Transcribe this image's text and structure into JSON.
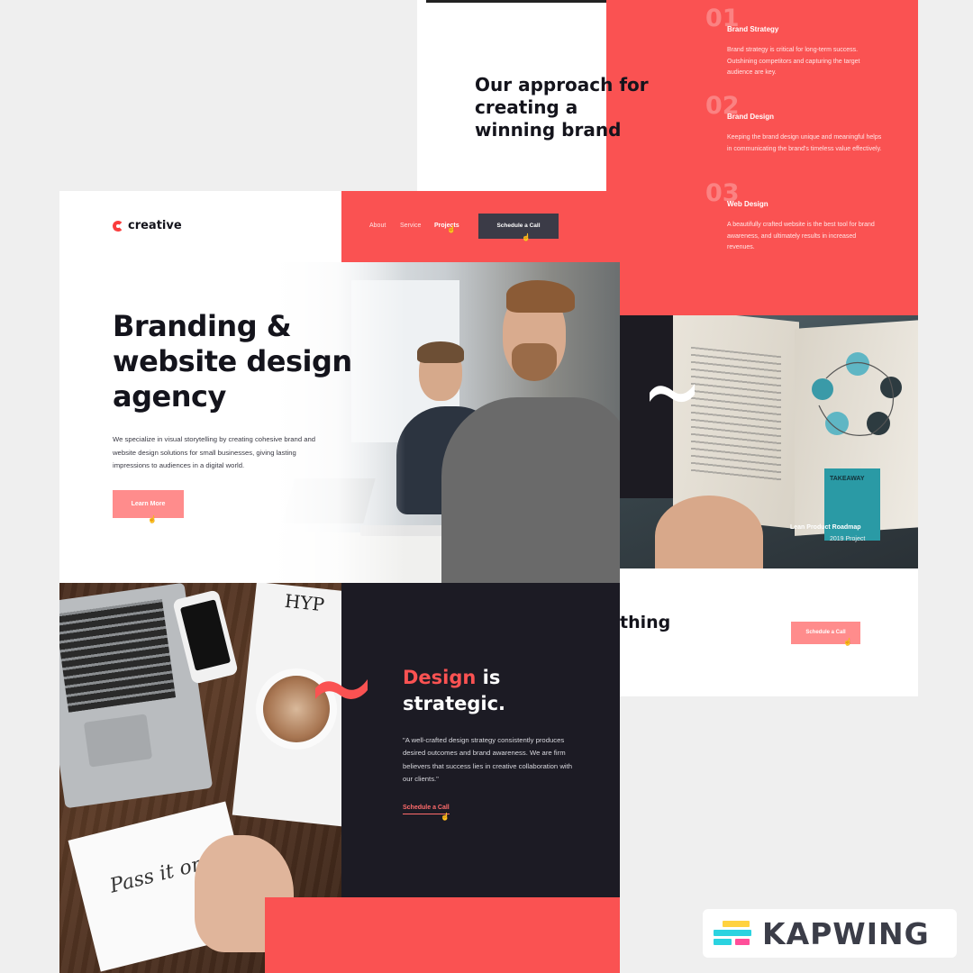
{
  "back_page": {
    "approach_title": "Our approach for creating a winning brand",
    "steps": [
      {
        "num": "01",
        "title": "Brand Strategy",
        "desc": "Brand strategy is critical for long-term success. Outshining competitors and capturing the target audience are key."
      },
      {
        "num": "02",
        "title": "Brand Design",
        "desc": "Keeping the brand design unique and meaningful helps in communicating the brand's timeless value effectively."
      },
      {
        "num": "03",
        "title": "Web Design",
        "desc": "A beautifully crafted website is the best tool for brand awareness, and ultimately results in increased revenues."
      }
    ],
    "project": {
      "title": "Lean Product Roadmap",
      "subtitle": "2019 Project",
      "book_label": "TAKEAWAY"
    },
    "partial_heading": "thing",
    "cta_label": "Schedule a Call"
  },
  "front_page": {
    "logo_text": "creative",
    "nav": {
      "links": [
        "About",
        "Service",
        "Projects"
      ],
      "active": "Projects",
      "cta_label": "Schedule a Call"
    },
    "hero": {
      "title": "Branding & website design agency",
      "description": "We specialize in visual storytelling by creating cohesive brand and website design solutions for small businesses, giving lasting impressions to audiences in a digital world.",
      "button_label": "Learn More"
    },
    "desk_photo": {
      "magazine_text": "HYP",
      "lettering": "Pass it on"
    },
    "strategic": {
      "title_accent": "Design",
      "title_rest_1": " is",
      "title_rest_2": "strategic.",
      "quote": "\"A well-crafted design strategy consistently produces desired outcomes and brand awareness. We are firm believers that success lies in creative collaboration with our clients.\"",
      "link_label": "Schedule a Call"
    }
  },
  "watermark": {
    "text": "KAPWING"
  },
  "colors": {
    "accent_red": "#fa5252",
    "button_pink": "#ff8c8c",
    "dark_navy": "#1c1b24",
    "nav_button": "#3b3b47",
    "page_bg": "#efefef",
    "kapwing_cyan": "#2bd3e0",
    "kapwing_yellow": "#ffd23f",
    "kapwing_pink": "#ff4f9a"
  },
  "icons": {
    "cursor": "hand-pointer-icon",
    "logo": "c-mark-icon",
    "swoosh": "tilde-swoosh-icon"
  }
}
